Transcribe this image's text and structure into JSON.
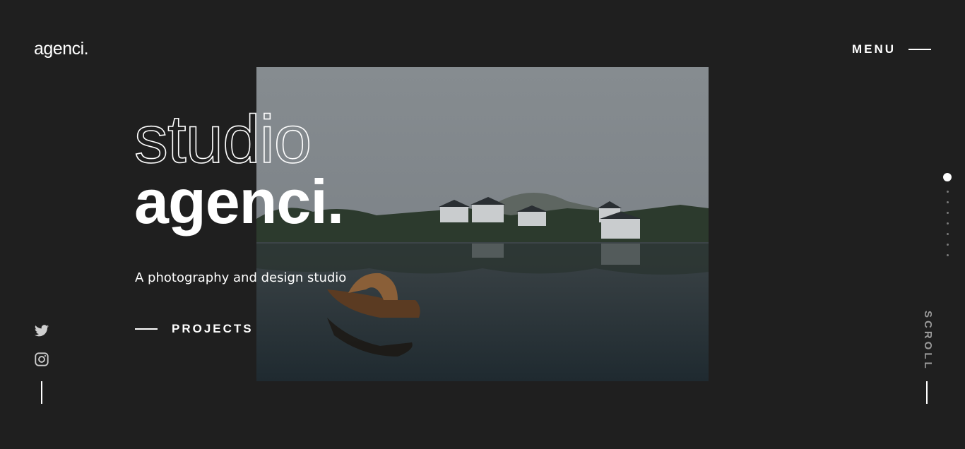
{
  "header": {
    "logo": "agenci.",
    "menu_label": "MENU"
  },
  "hero": {
    "title_outline": "studio",
    "title_solid": "agenci.",
    "subtitle": "A photography and design studio",
    "cta_label": "PROJECTS",
    "image_alt": "Lake with wooden boat and village houses"
  },
  "social": {
    "icons": [
      "twitter-icon",
      "instagram-icon"
    ]
  },
  "slider": {
    "total": 8,
    "active_index": 0
  },
  "scroll_label": "SCROLL",
  "colors": {
    "background": "#1f1f1f",
    "text": "#ffffff",
    "muted": "#9a9a9a"
  }
}
